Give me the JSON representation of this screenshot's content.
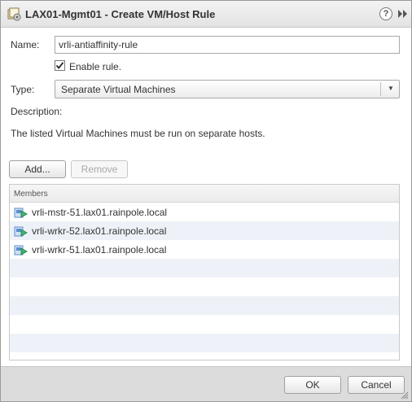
{
  "window": {
    "title": "LAX01-Mgmt01 - Create VM/Host Rule",
    "help_glyph": "?",
    "icon": "vm-host-rule-icon"
  },
  "form": {
    "name_label": "Name:",
    "name_value": "vrli-antiaffinity-rule",
    "enable_label": "Enable rule.",
    "enable_checked": true,
    "type_label": "Type:",
    "type_value": "Separate Virtual Machines",
    "description_label": "Description:",
    "description_text": "The listed Virtual Machines must be run on separate hosts."
  },
  "actions": {
    "add_label": "Add...",
    "remove_label": "Remove"
  },
  "members": {
    "header": "Members",
    "items": [
      "vrli-mstr-51.lax01.rainpole.local",
      "vrli-wrkr-52.lax01.rainpole.local",
      "vrli-wrkr-51.lax01.rainpole.local"
    ]
  },
  "footer": {
    "ok_label": "OK",
    "cancel_label": "Cancel"
  },
  "colors": {
    "row_alt": "#eef2f8",
    "footer_bg": "#dcdcdc",
    "vm_icon_green": "#3cb371",
    "vm_icon_blue": "#5b8ecf"
  }
}
